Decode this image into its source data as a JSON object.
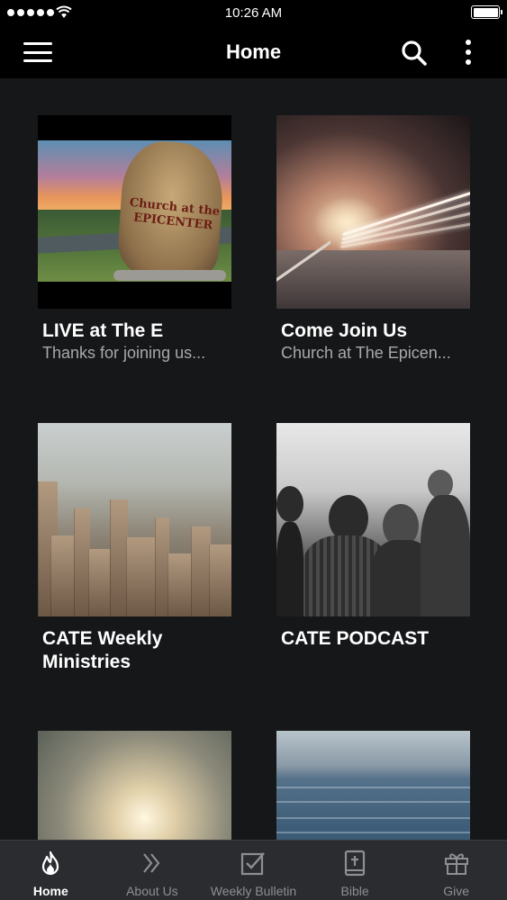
{
  "status_bar": {
    "time": "10:26 AM"
  },
  "header": {
    "title": "Home"
  },
  "tiles": [
    {
      "title": "LIVE at The E",
      "subtitle": "Thanks for joining us..."
    },
    {
      "title": "Come Join Us",
      "subtitle": "Church at The Epicen..."
    },
    {
      "title": "CATE Weekly Ministries",
      "subtitle": ""
    },
    {
      "title": "CATE PODCAST",
      "subtitle": ""
    },
    {
      "title": "",
      "subtitle": ""
    },
    {
      "title": "",
      "subtitle": ""
    }
  ],
  "rock_sign": {
    "line1": "Church at the",
    "line2": "EPICENTER"
  },
  "tab_bar": {
    "active": "Home",
    "items": [
      {
        "label": "Home",
        "icon": "flame-icon"
      },
      {
        "label": "About Us",
        "icon": "double-chevron-right-icon"
      },
      {
        "label": "Weekly Bulletin",
        "icon": "checkbox-icon"
      },
      {
        "label": "Bible",
        "icon": "bible-icon"
      },
      {
        "label": "Give",
        "icon": "gift-icon"
      }
    ]
  },
  "colors": {
    "background": "#161719",
    "header": "#000000",
    "tab_bar": "#2b2c30",
    "subtitle": "#a9a9ab",
    "tab_inactive": "#8e8f93"
  }
}
